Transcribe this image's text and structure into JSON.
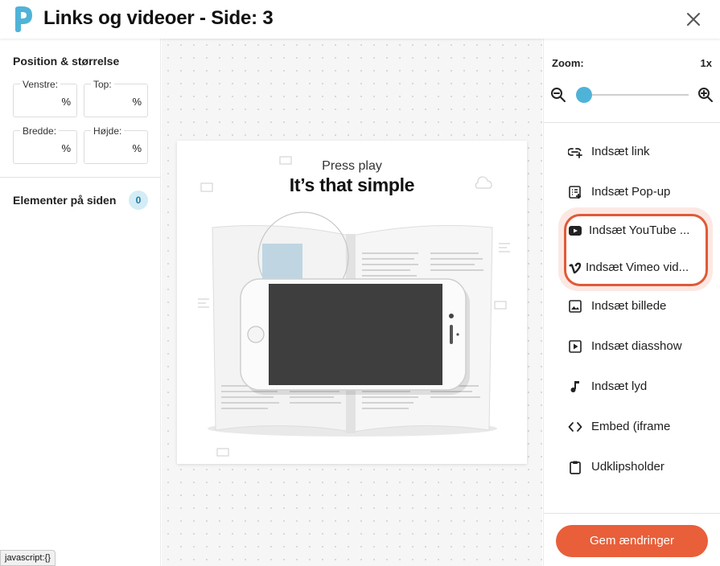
{
  "header": {
    "title": "Links og videoer - Side: 3",
    "logo_icon": "brand-p-logo",
    "close_icon": "close-icon"
  },
  "left_panel": {
    "section_title": "Position & størrelse",
    "fields": [
      {
        "label": "Venstre:",
        "value": "",
        "unit": "%"
      },
      {
        "label": "Top:",
        "value": "",
        "unit": "%"
      },
      {
        "label": "Bredde:",
        "value": "",
        "unit": "%"
      },
      {
        "label": "Højde:",
        "value": "",
        "unit": "%"
      }
    ],
    "elements_title": "Elementer på siden",
    "elements_count": "0"
  },
  "canvas": {
    "page": {
      "kicker": "Press play",
      "headline": "It’s that simple"
    }
  },
  "right_panel": {
    "zoom_label": "Zoom:",
    "zoom_value": "1x",
    "zoom_level_fraction": 0.0,
    "items": [
      {
        "label": "Indsæt link",
        "icon": "link-add-icon"
      },
      {
        "label": "Indsæt Pop-up",
        "icon": "popup-icon"
      },
      {
        "label": "Indsæt YouTube ...",
        "icon": "youtube-icon"
      },
      {
        "label": "Indsæt Vimeo vid...",
        "icon": "vimeo-icon"
      },
      {
        "label": "Indsæt billede",
        "icon": "image-icon"
      },
      {
        "label": "Indsæt diasshow",
        "icon": "slideshow-icon"
      },
      {
        "label": "Indsæt lyd",
        "icon": "music-note-icon"
      },
      {
        "label": "Embed (iframe",
        "icon": "code-icon"
      },
      {
        "label": "Udklipsholder",
        "icon": "clipboard-icon"
      }
    ],
    "save_label": "Gem ændringer"
  },
  "status_bar": {
    "text": "javascript:{}"
  },
  "colors": {
    "accent": "#e85f3a",
    "slider": "#4fb3d8",
    "badge_bg": "#d3ecf6",
    "brand": "#4fb3d8"
  }
}
